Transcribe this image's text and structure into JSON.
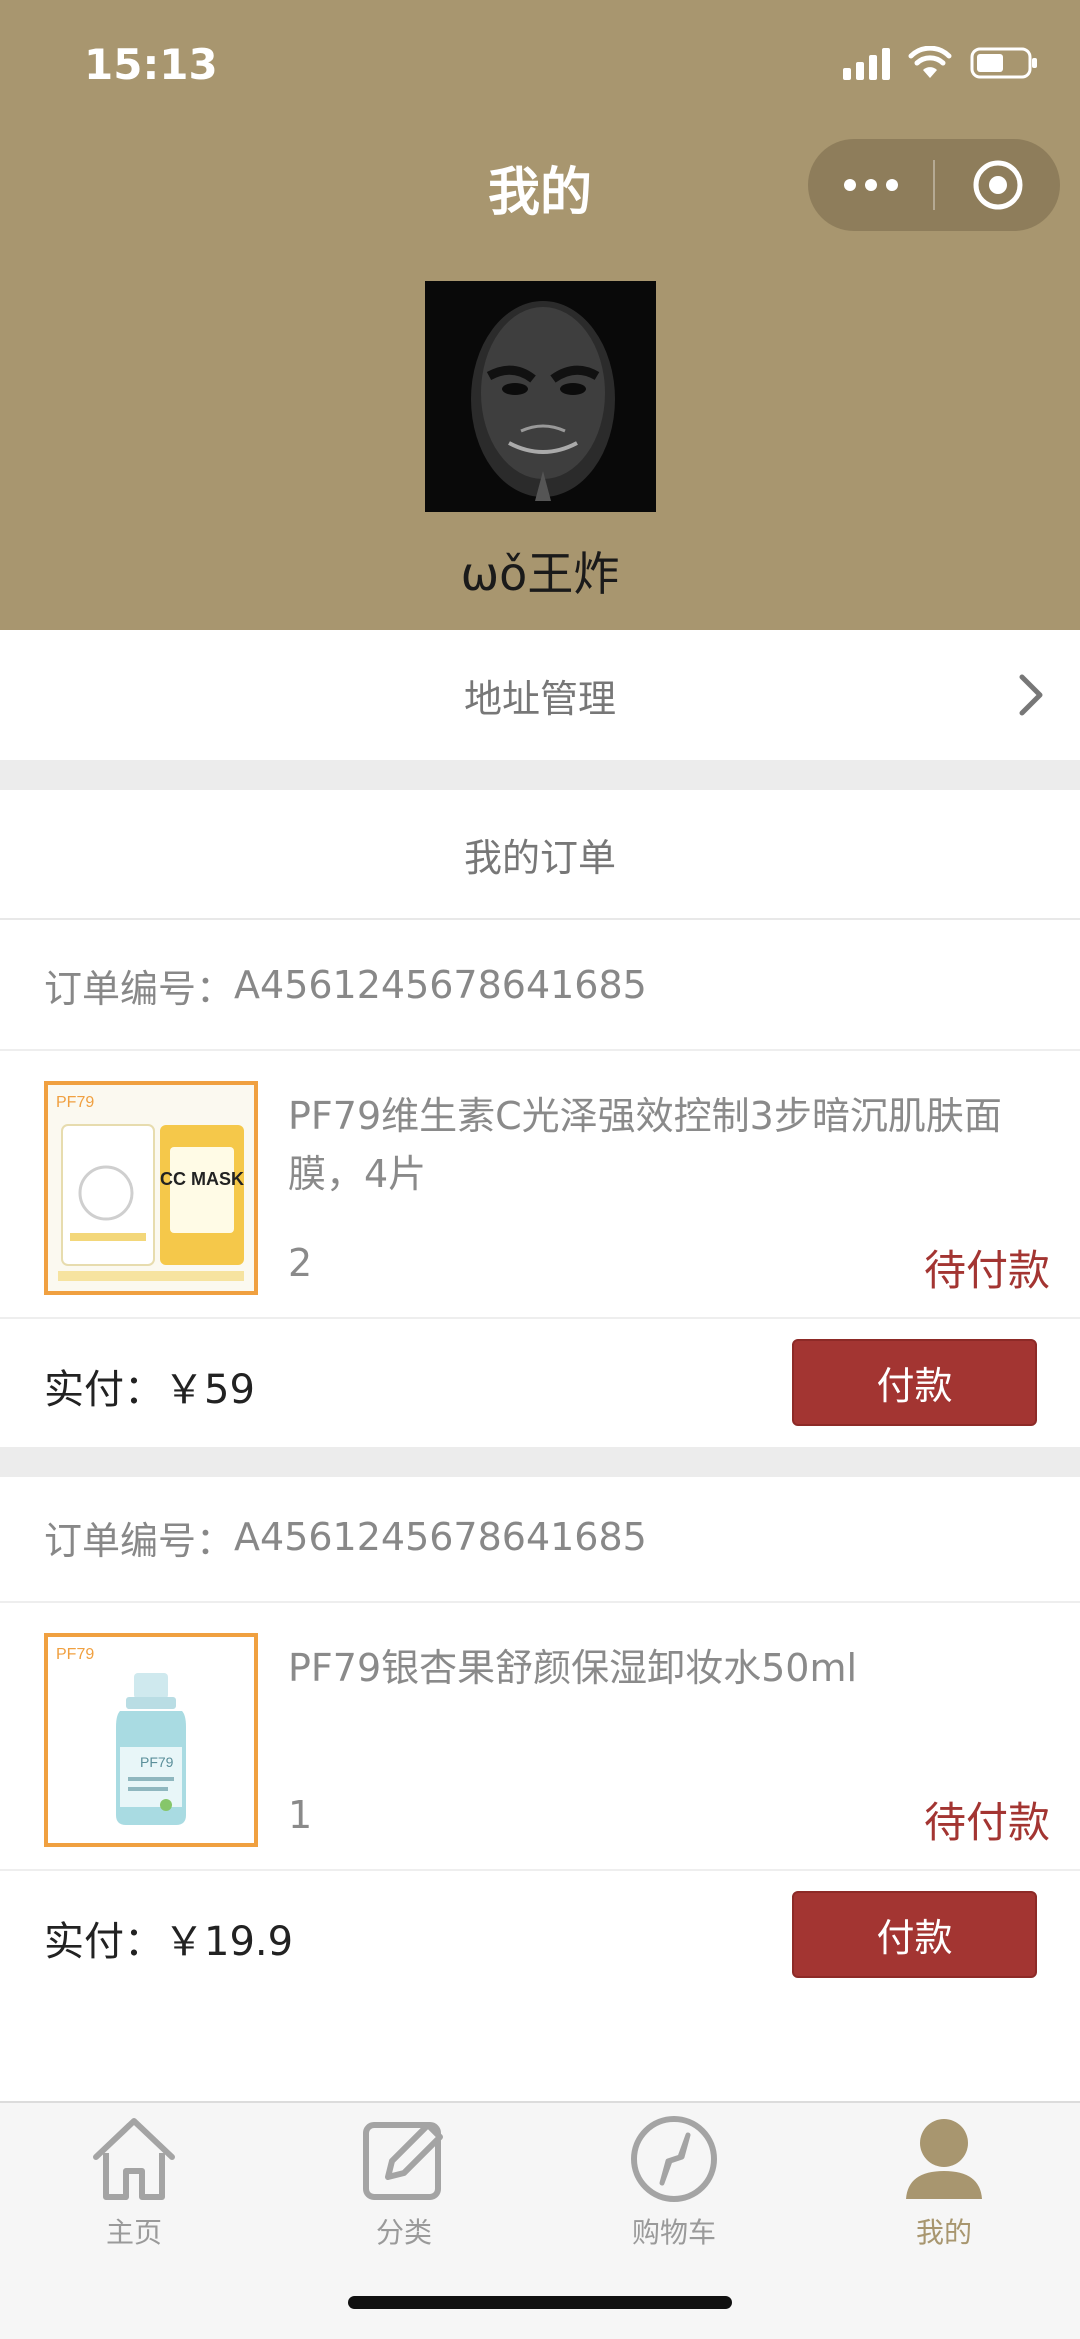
{
  "status_bar": {
    "time": "15:13"
  },
  "nav": {
    "title": "我的"
  },
  "profile": {
    "username": "ωǒ王炸"
  },
  "address": {
    "label": "地址管理"
  },
  "orders": {
    "title": "我的订单",
    "order_no_label": "订单编号：",
    "paid_label": "实付：",
    "items": [
      {
        "order_no": "A4561245678641685",
        "product_name": "PF79维生素C光泽强效控制3步暗沉肌肤面膜，4片",
        "quantity": "2",
        "status": "待付款",
        "amount": "￥59",
        "pay_label": "付款",
        "thumb_icon": "face-mask-product-image",
        "thumb_brand": "PF79",
        "thumb_text": "CC MASK"
      },
      {
        "order_no": "A4561245678641685",
        "product_name": "PF79银杏果舒颜保湿卸妆水50ml",
        "quantity": "1",
        "status": "待付款",
        "amount": "￥19.9",
        "pay_label": "付款",
        "thumb_icon": "cleansing-water-product-image",
        "thumb_brand": "PF79"
      }
    ]
  },
  "tabbar": {
    "items": [
      {
        "label": "主页",
        "icon": "home-icon"
      },
      {
        "label": "分类",
        "icon": "edit-icon"
      },
      {
        "label": "购物车",
        "icon": "compass-icon"
      },
      {
        "label": "我的",
        "icon": "user-icon"
      }
    ],
    "active_index": 3
  },
  "colors": {
    "header_bg": "#a8966f",
    "accent_red": "#a33532",
    "thumb_border": "#f0a040",
    "tab_active": "#a8966f"
  }
}
